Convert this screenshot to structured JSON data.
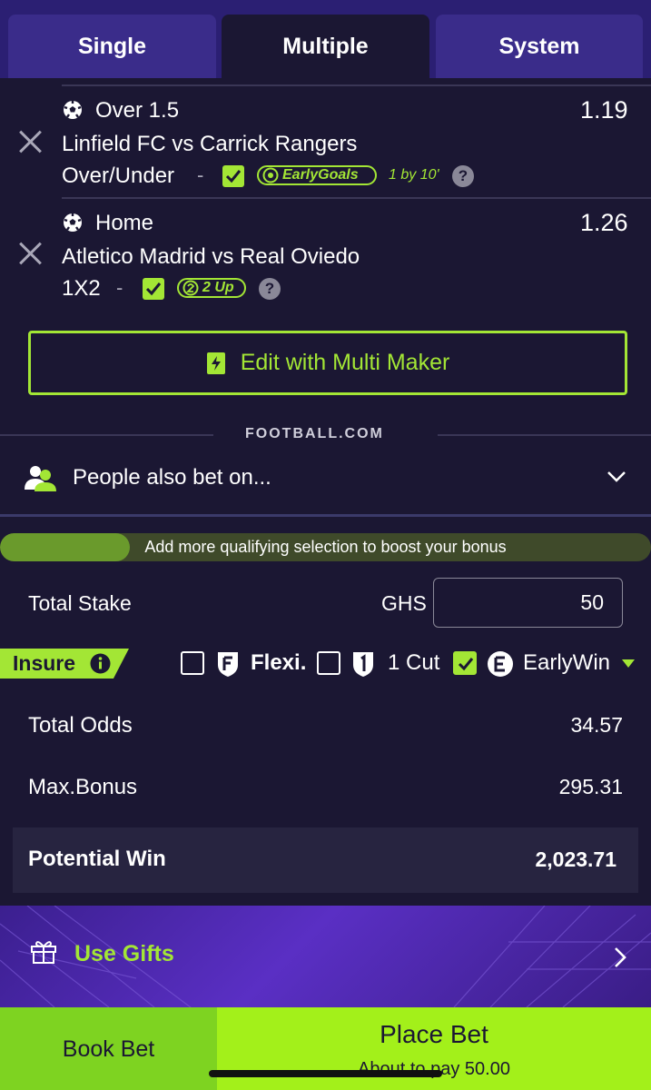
{
  "tabs": [
    "Single",
    "Multiple",
    "System"
  ],
  "selections": [
    {
      "pick": "Over 1.5",
      "match": "Linfield FC vs Carrick Rangers",
      "market": "Over/Under",
      "separator": "-",
      "odds": "1.19",
      "badge": "EarlyGoals",
      "badge_note": "1 by 10'"
    },
    {
      "pick": "Home",
      "match": "Atletico Madrid vs Real Oviedo",
      "market": "1X2",
      "separator": "-",
      "odds": "1.26",
      "badge": "2 Up"
    }
  ],
  "multi_maker_label": "Edit with Multi Maker",
  "brand": "FOOTBALL.COM",
  "people_also_bet": "People also bet on...",
  "bonus_text": "Add more qualifying selection to boost your bonus",
  "bonus_progress": 0.2,
  "stake": {
    "label": "Total Stake",
    "currency": "GHS",
    "value": "50"
  },
  "insure": {
    "label": "Insure",
    "options": [
      {
        "label": "Flexi.",
        "checked": false
      },
      {
        "label": "1 Cut",
        "checked": false
      },
      {
        "label": "EarlyWin",
        "checked": true
      }
    ]
  },
  "summary": {
    "total_odds_label": "Total Odds",
    "total_odds": "34.57",
    "max_bonus_label": "Max.Bonus",
    "max_bonus": "295.31",
    "potential_win_label": "Potential Win",
    "potential_win": "2,023.71"
  },
  "gifts_label": "Use Gifts",
  "book_bet_label": "Book Bet",
  "place_bet_label": "Place Bet",
  "pay_text": "About to pay 50.00",
  "colors": {
    "accent": "#a3e635",
    "background": "#1b1733",
    "tab_bar": "#2b1f73"
  }
}
